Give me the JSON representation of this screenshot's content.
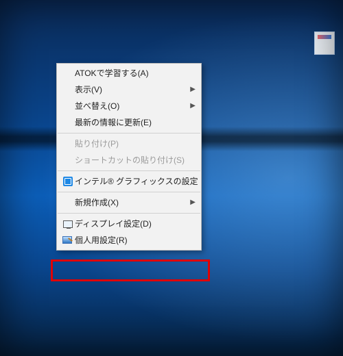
{
  "context_menu": {
    "items": [
      {
        "id": "atok-learn",
        "label": "ATOKで学習する(A)",
        "enabled": true,
        "submenu": false,
        "icon": null
      },
      {
        "id": "view",
        "label": "表示(V)",
        "enabled": true,
        "submenu": true,
        "icon": null
      },
      {
        "id": "sort",
        "label": "並べ替え(O)",
        "enabled": true,
        "submenu": true,
        "icon": null
      },
      {
        "id": "refresh",
        "label": "最新の情報に更新(E)",
        "enabled": true,
        "submenu": false,
        "icon": null
      },
      {
        "separator": true
      },
      {
        "id": "paste",
        "label": "貼り付け(P)",
        "enabled": false,
        "submenu": false,
        "icon": null
      },
      {
        "id": "paste-shortcut",
        "label": "ショートカットの貼り付け(S)",
        "enabled": false,
        "submenu": false,
        "icon": null
      },
      {
        "separator": true
      },
      {
        "id": "intel-gfx",
        "label": "インテル® グラフィックスの設定",
        "enabled": true,
        "submenu": false,
        "icon": "intel-icon"
      },
      {
        "separator": true
      },
      {
        "id": "new",
        "label": "新規作成(X)",
        "enabled": true,
        "submenu": true,
        "icon": null
      },
      {
        "separator": true
      },
      {
        "id": "display",
        "label": "ディスプレイ設定(D)",
        "enabled": true,
        "submenu": false,
        "icon": "display-icon"
      },
      {
        "id": "personalize",
        "label": "個人用設定(R)",
        "enabled": true,
        "submenu": false,
        "icon": "personalize-icon"
      }
    ]
  },
  "highlight_target_id": "personalize",
  "arrow_glyph": "▶",
  "colors": {
    "highlight": "#e00000"
  }
}
